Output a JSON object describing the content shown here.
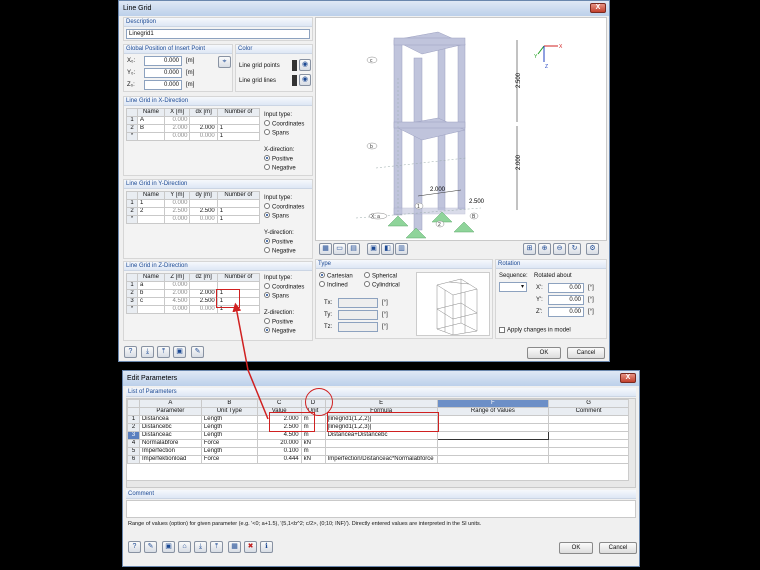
{
  "line_grid": {
    "title": "Line Grid",
    "close": "X",
    "description": {
      "header": "Description",
      "value": "Linegrid1"
    },
    "insert_point": {
      "header": "Global Position of Insert Point",
      "rows": [
        {
          "label": "X₀:",
          "value": "0.000",
          "unit": "[m]"
        },
        {
          "label": "Y₀:",
          "value": "0.000",
          "unit": "[m]"
        },
        {
          "label": "Z₀:",
          "value": "0.000",
          "unit": "[m]"
        }
      ]
    },
    "color": {
      "header": "Color",
      "points_label": "Line grid points",
      "lines_label": "Line grid lines"
    },
    "x_dir": {
      "header": "Line Grid in X-Direction",
      "cols": [
        "",
        "Name",
        "X [m]",
        "dx [m]",
        "Number of"
      ],
      "rows": [
        [
          "1",
          "A",
          "0.000",
          "",
          ""
        ],
        [
          "2",
          "B",
          "2.000",
          "2.000",
          "1"
        ],
        [
          "*",
          "",
          "0.000",
          "0.000",
          "1"
        ]
      ],
      "input_type": "Input type:",
      "opt1": "Coordinates",
      "opt2": "Spans",
      "dir_label": "X-direction:",
      "dir1": "Positive",
      "dir2": "Negative"
    },
    "y_dir": {
      "header": "Line Grid in Y-Direction",
      "cols": [
        "",
        "Name",
        "Y [m]",
        "dy [m]",
        "Number of"
      ],
      "rows": [
        [
          "1",
          "1",
          "0.000",
          "",
          ""
        ],
        [
          "2",
          "2",
          "2.500",
          "2.500",
          "1"
        ],
        [
          "*",
          "",
          "0.000",
          "0.000",
          "1"
        ]
      ],
      "input_type": "Input type:",
      "opt1": "Coordinates",
      "opt2": "Spans",
      "dir_label": "Y-direction:",
      "dir1": "Positive",
      "dir2": "Negative"
    },
    "z_dir": {
      "header": "Line Grid in Z-Direction",
      "cols": [
        "",
        "Name",
        "Z [m]",
        "dz [m]",
        "Number of"
      ],
      "rows": [
        [
          "1",
          "a",
          "0.000",
          "",
          ""
        ],
        [
          "2",
          "b",
          "2.000",
          "2.000",
          "1"
        ],
        [
          "3",
          "c",
          "4.500",
          "2.500",
          "1"
        ],
        [
          "*",
          "",
          "0.000",
          "0.000",
          "1"
        ]
      ],
      "input_type": "Input type:",
      "opt1": "Coordinates",
      "opt2": "Spans",
      "dir_label": "Z-direction:",
      "dir1": "Positive",
      "dir2": "Negative"
    },
    "view": {
      "dim_top": "2.500",
      "dim_mid": "2.000",
      "dim_x": "2.000",
      "dim_y": "2.500",
      "lbl_c": "c",
      "lbl_b": "b",
      "lbl_a": "X: a",
      "lbl_1": "1",
      "lbl_2": "2",
      "lbl_B": "B",
      "axis_x": "X",
      "axis_y": "Y",
      "axis_z": "Z"
    },
    "type": {
      "header": "Type",
      "opt_cart": "Cartesian",
      "opt_incl": "Inclined",
      "opt_sph": "Spherical",
      "opt_cyl": "Cylindrical",
      "tx": "Tx:",
      "ty": "Ty:",
      "tz": "Tz:",
      "unit": "[°]"
    },
    "rotation": {
      "header": "Rotation",
      "sequence": "Sequence:",
      "rotated_about": "Rotated about",
      "rx": "X':",
      "ry": "Y':",
      "rz": "Z':",
      "rx_val": "0.00",
      "ry_val": "0.00",
      "rz_val": "0.00",
      "unit": "[°]",
      "apply": "Apply changes in model"
    },
    "ok": "OK",
    "cancel": "Cancel"
  },
  "edit_params": {
    "title": "Edit Parameters",
    "close": "X",
    "list_header": "List of Parameters",
    "col_letters": [
      "",
      "A",
      "B",
      "C",
      "D",
      "E",
      "F",
      "G"
    ],
    "cols": [
      "",
      "Parameter",
      "Unit Type",
      "Value",
      "Unit",
      "Formula",
      "Range of Values",
      "Comment"
    ],
    "rows": [
      [
        "1",
        "Distancea",
        "Length",
        "2.000",
        "m",
        "[linegrid1(1,Z,2)]",
        "",
        ""
      ],
      [
        "2",
        "Distancebc",
        "Length",
        "2.500",
        "m",
        "[linegrid1(1,Z,3)]",
        "",
        ""
      ],
      [
        "3",
        "Distanceac",
        "Length",
        "4.500",
        "m",
        "Distancea+Distancebc",
        "",
        ""
      ],
      [
        "4",
        "Normalabfore",
        "Force",
        "20.000",
        "kN",
        "",
        "",
        ""
      ],
      [
        "5",
        "Imperfection",
        "Length",
        "0.100",
        "m",
        "",
        "",
        ""
      ],
      [
        "6",
        "Imperfektionload",
        "Force",
        "0.444",
        "kN",
        "Imperfection/Distanceac*Normalabforce",
        "",
        ""
      ]
    ],
    "comment_header": "Comment",
    "hint": "Range of values (option) for given parameter (e.g. '<0; a+1.5), '(5,1<b^2; c/2>, (0;10; INF)'). Directly entered values are interpreted in the SI units.",
    "ok": "OK",
    "cancel": "Cancel"
  }
}
